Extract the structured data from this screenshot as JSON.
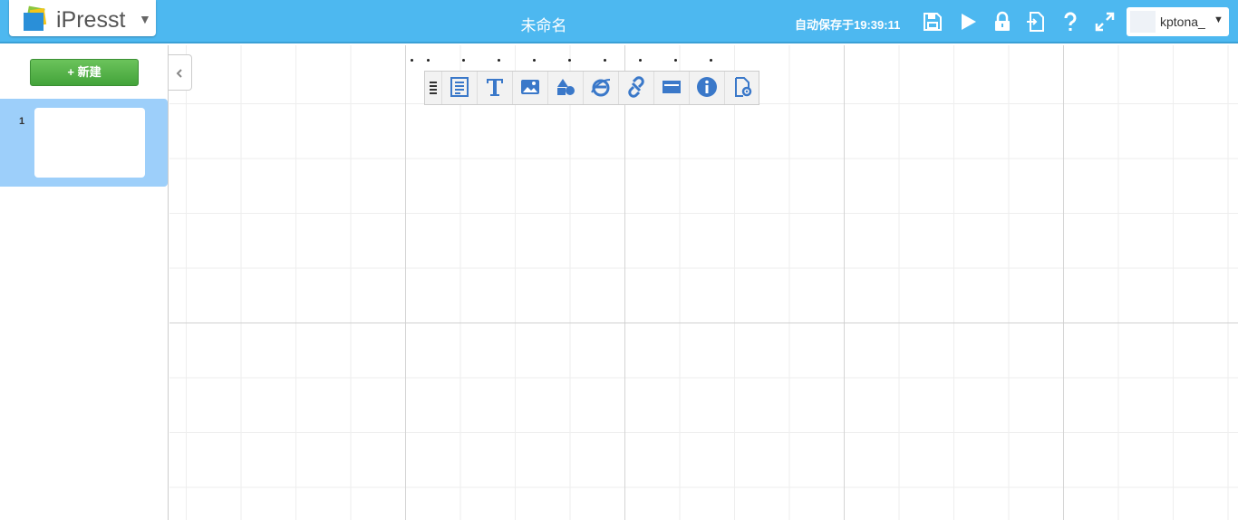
{
  "app": {
    "name": "iPresst",
    "document_title": "未命名",
    "autosave_text": "自动保存于19:39:11"
  },
  "toolbar_icons": [
    "save-icon",
    "play-icon",
    "lock-icon",
    "import-icon",
    "help-icon",
    "fullscreen-icon"
  ],
  "user": {
    "name": "kptona_"
  },
  "sidebar": {
    "new_button_label": "+ 新建",
    "slides": [
      {
        "number": "1"
      }
    ]
  },
  "insert_toolbar": {
    "tools": [
      "text-frame-icon",
      "text-icon",
      "image-icon",
      "shape-icon",
      "web-icon",
      "link-icon",
      "media-icon",
      "info-icon",
      "settings-icon"
    ]
  },
  "colors": {
    "header": "#4db8f0",
    "accent_icon": "#3a78c9",
    "new_button": "#4fac42",
    "selected_slide": "#9dcffa"
  }
}
